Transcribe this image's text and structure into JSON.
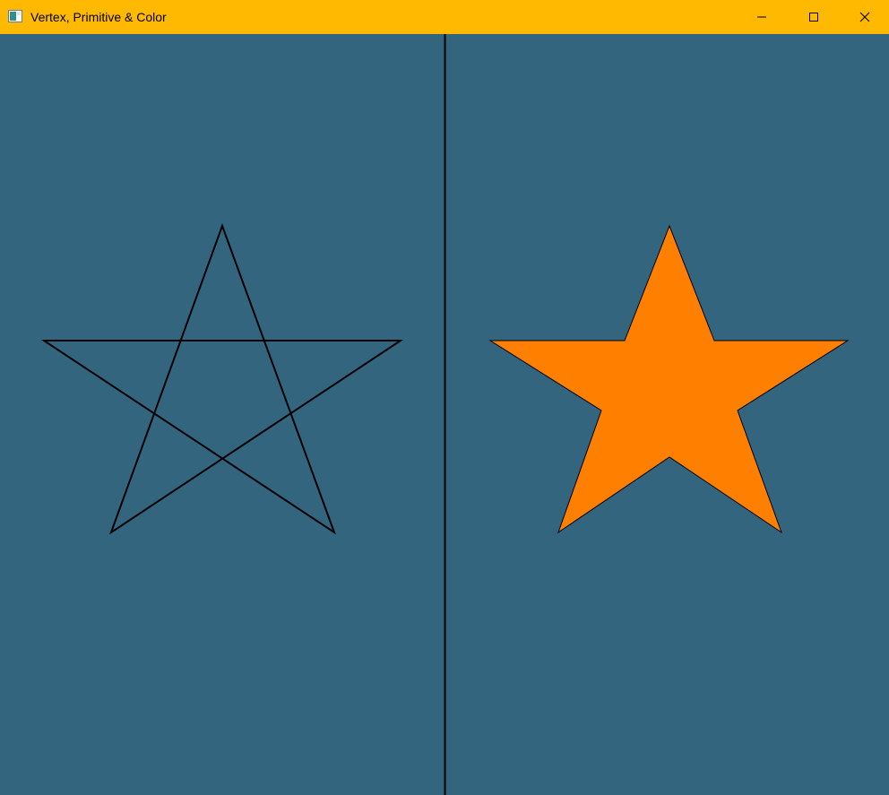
{
  "window": {
    "title": "Vertex, Primitive & Color",
    "titlebar_color": "#ffb900",
    "controls": [
      "minimize-icon",
      "maximize-icon",
      "close-icon"
    ]
  },
  "scene": {
    "background_color": "#33657f",
    "divider_color": "#000000",
    "left_star": {
      "style": "outline",
      "stroke_color": "#000000"
    },
    "right_star": {
      "style": "filled",
      "fill_color": "#ff7f00",
      "stroke_color": "#000000"
    }
  }
}
